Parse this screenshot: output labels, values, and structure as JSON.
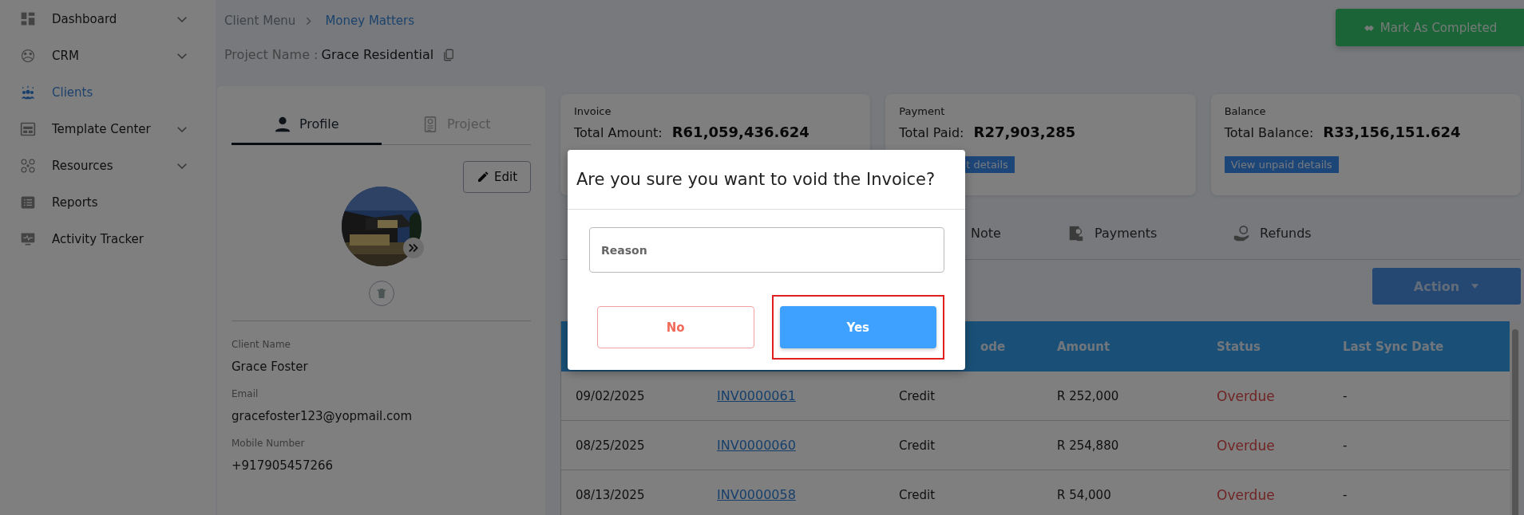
{
  "sidebar": {
    "items": [
      {
        "label": "Dashboard",
        "selected": false,
        "submenu": true
      },
      {
        "label": "CRM",
        "selected": false,
        "submenu": true
      },
      {
        "label": "Clients",
        "selected": true,
        "submenu": false
      },
      {
        "label": "Template Center",
        "selected": false,
        "submenu": true
      },
      {
        "label": "Resources",
        "selected": false,
        "submenu": true
      },
      {
        "label": "Reports",
        "selected": false,
        "submenu": false
      },
      {
        "label": "Activity Tracker",
        "selected": false,
        "submenu": false
      }
    ]
  },
  "breadcrumb": [
    "Client Menu",
    "Money Matters"
  ],
  "project": {
    "label": "Project Name :",
    "value": "Grace Residential"
  },
  "mark_completed_button": "Mark As Completed",
  "profile_panel": {
    "tabs": [
      {
        "label": "Profile",
        "selected": true
      },
      {
        "label": "Project",
        "selected": false
      }
    ],
    "edit_button": "Edit",
    "fields": [
      {
        "label": "Client Name",
        "value": "Grace Foster"
      },
      {
        "label": "Email",
        "value": "gracefoster123@yopmail.com"
      },
      {
        "label": "Mobile Number",
        "value": "+917905457266"
      }
    ]
  },
  "summary_cards": [
    {
      "title": "Invoice",
      "label": "Total Amount:",
      "value": "R61,059,436.624"
    },
    {
      "title": "Payment",
      "label": "Total Paid:",
      "value": "R27,903,285",
      "button": "t details"
    },
    {
      "title": "Balance",
      "label": "Total Balance:",
      "value": "R33,156,151.624",
      "button": "View unpaid details"
    }
  ],
  "tabs": [
    {
      "label": "Note"
    },
    {
      "label": "Payments"
    },
    {
      "label": "Refunds"
    }
  ],
  "action_button": "Action",
  "table": {
    "columns": [
      "ode",
      "Amount",
      "Status",
      "Last Sync Date"
    ],
    "rows": [
      {
        "date": "09/02/2025",
        "invoice": "INV0000061",
        "mode": "Credit",
        "amount": "R 252,000",
        "status": "Overdue",
        "last_sync": "-"
      },
      {
        "date": "08/25/2025",
        "invoice": "INV0000060",
        "mode": "Credit",
        "amount": "R 254,880",
        "status": "Overdue",
        "last_sync": "-"
      },
      {
        "date": "08/13/2025",
        "invoice": "INV0000058",
        "mode": "Credit",
        "amount": "R 54,000",
        "status": "Overdue",
        "last_sync": "-"
      }
    ]
  },
  "modal": {
    "title": "Are you sure you want to void the Invoice?",
    "reason_placeholder": "Reason",
    "buttons": [
      {
        "label": "No",
        "kind": "secondary",
        "highlighted": false
      },
      {
        "label": "Yes",
        "kind": "primary",
        "highlighted": true
      }
    ]
  }
}
